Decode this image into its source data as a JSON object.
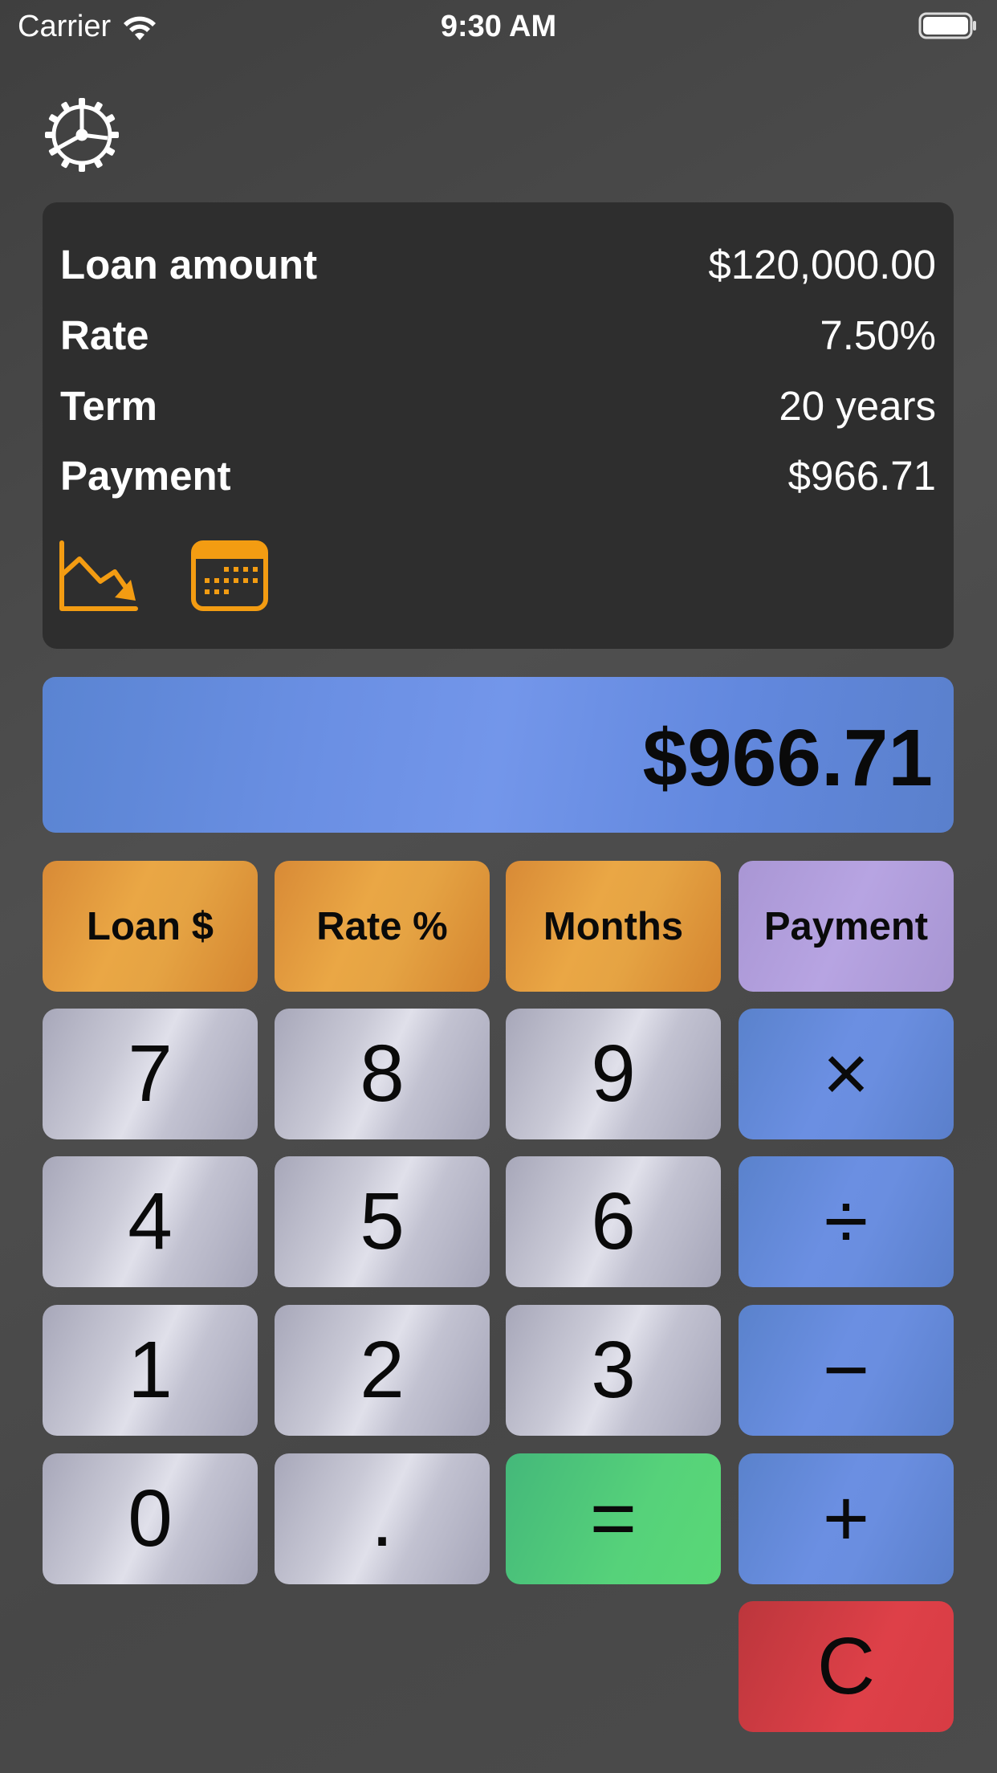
{
  "status_bar": {
    "carrier": "Carrier",
    "time": "9:30 AM"
  },
  "summary": {
    "rows": [
      {
        "label": "Loan amount",
        "value": "$120,000.00"
      },
      {
        "label": "Rate",
        "value": "7.50%"
      },
      {
        "label": "Term",
        "value": "20 years"
      },
      {
        "label": "Payment",
        "value": "$966.71"
      }
    ]
  },
  "display": {
    "value": "$966.71"
  },
  "keys": {
    "loan": "Loan $",
    "rate": "Rate %",
    "months": "Months",
    "payment": "Payment",
    "k7": "7",
    "k8": "8",
    "k9": "9",
    "multiply": "×",
    "k4": "4",
    "k5": "5",
    "k6": "6",
    "divide": "÷",
    "k1": "1",
    "k2": "2",
    "k3": "3",
    "minus": "−",
    "k0": "0",
    "decimal": ".",
    "equals": "=",
    "plus": "+",
    "clear": "C"
  },
  "icons": {
    "settings": "gear-icon",
    "amortization": "chart-down-icon",
    "schedule": "calendar-icon"
  },
  "colors": {
    "accent_orange": "#f39c12",
    "func_key": "#e5a343",
    "payment_key": "#b7a4e2",
    "operator_key": "#6a8ee0",
    "equals_key": "#56d27a",
    "clear_key": "#de4048",
    "display": "#7396ea"
  }
}
